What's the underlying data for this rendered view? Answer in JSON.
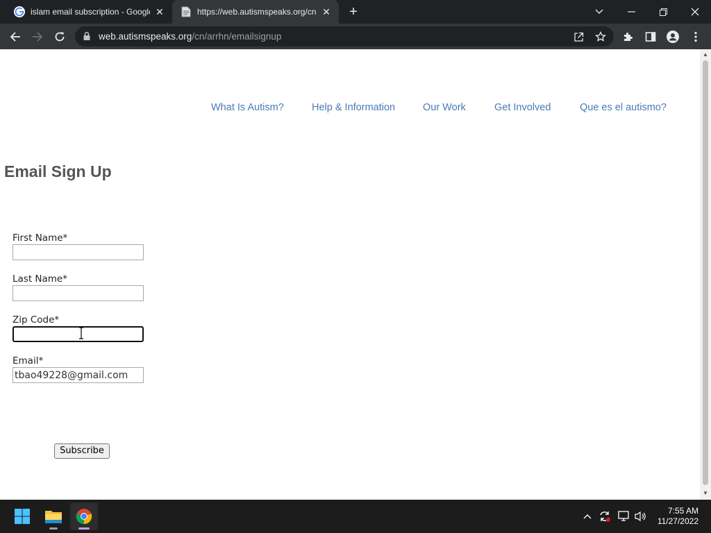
{
  "browser": {
    "tabs": [
      {
        "title": "islam email subscription - Google",
        "favicon": "google-icon",
        "active": false
      },
      {
        "title": "https://web.autismspeaks.org/cn",
        "favicon": "page-icon",
        "active": true
      }
    ],
    "url_host": "web.autismspeaks.org",
    "url_path": "/cn/arrhn/emailsignup"
  },
  "site": {
    "nav": [
      "What Is Autism?",
      "Help & Information",
      "Our Work",
      "Get Involved",
      "Que es el autismo?"
    ],
    "link_color": "#4a7ab5"
  },
  "form": {
    "heading": "Email Sign Up",
    "first_name_label": "First Name*",
    "first_name_value": "",
    "last_name_label": "Last Name*",
    "last_name_value": "",
    "zip_label": "Zip Code*",
    "zip_value": "",
    "email_label": "Email*",
    "email_value": "tbao49228@gmail.com",
    "submit_label": "Subscribe"
  },
  "taskbar": {
    "time": "7:55 AM",
    "date": "11/27/2022",
    "apps": [
      "windows-start-icon",
      "file-explorer-icon",
      "chrome-icon"
    ]
  }
}
